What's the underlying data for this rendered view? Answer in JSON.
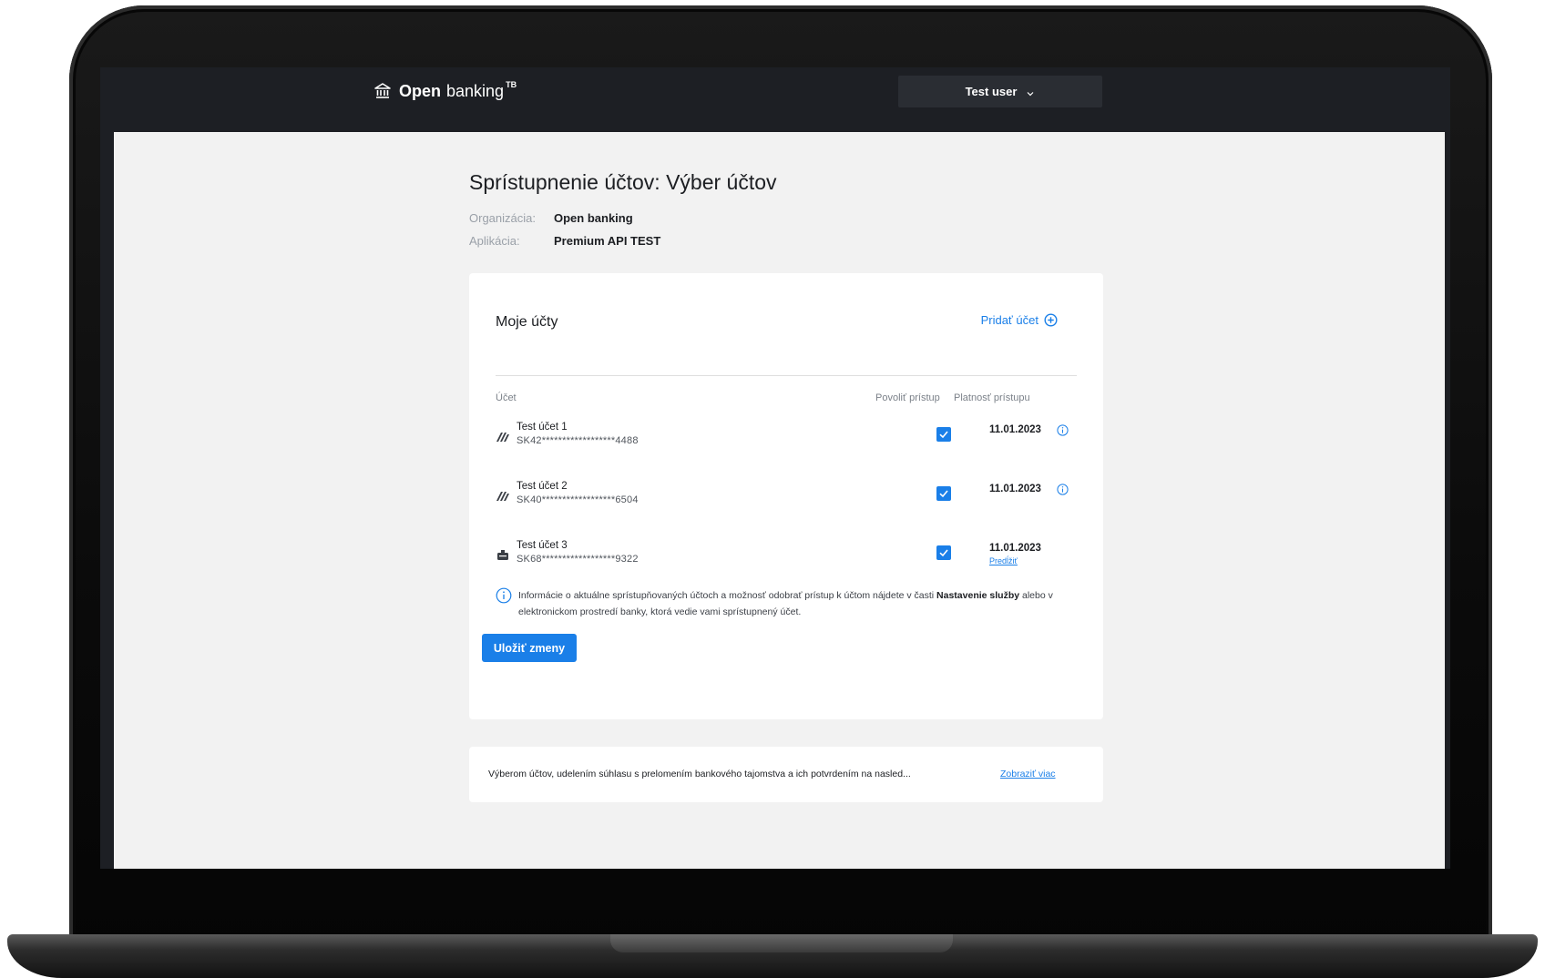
{
  "header": {
    "brand_name": "Open",
    "brand_sub": "banking",
    "brand_sup": "TB",
    "user_label": "Test user"
  },
  "page": {
    "title": "Sprístupnenie účtov: Výber účtov",
    "organization_label": "Organizácia:",
    "organization_value": "Open banking",
    "application_label": "Aplikácia:",
    "application_value": "Premium API TEST"
  },
  "accounts_card": {
    "title": "Moje účty",
    "add_account_label": "Pridať účet",
    "col_account": "Účet",
    "col_allow": "Povoliť prístup",
    "col_validity": "Platnosť prístupu",
    "rows": [
      {
        "name": "Test účet 1",
        "iban": "SK42******************4488",
        "allowed": true,
        "valid_until": "11.01.2023",
        "icon": "card-stack-icon"
      },
      {
        "name": "Test účet 2",
        "iban": "SK40******************6504",
        "allowed": true,
        "valid_until": "11.01.2023",
        "icon": "card-stack-icon"
      },
      {
        "name": "Test účet 3",
        "iban": "SK68******************9322",
        "allowed": true,
        "valid_until": "11.01.2023",
        "extend_label": "Predĺžiť",
        "icon": "piggy-bank-icon"
      }
    ],
    "notice_part1": "Informácie o aktuálne sprístupňovaných účtoch a možnosť odobrať prístup k účtom nájdete v časti ",
    "notice_bold1": "Nastavenie služby",
    "notice_part2": " alebo v elektronickom prostredí banky, ktorá vedie vami sprístupnený účet.",
    "save_label": "Uložiť zmeny"
  },
  "consent_card": {
    "text": "Výberom účtov, udelením súhlasu s prelomením bankového tajomstva a ich potvrdením na nasled...",
    "show_more_label": "Zobraziť viac"
  },
  "colors": {
    "accent": "#1a7fe8",
    "header_bg": "#1d1f24",
    "page_bg": "#f2f2f2"
  }
}
